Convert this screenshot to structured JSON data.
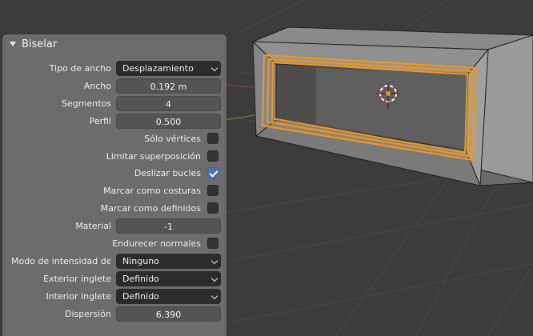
{
  "panel": {
    "title": "Biselar",
    "rows": {
      "width_type": {
        "label": "Tipo de ancho",
        "value": "Desplazamiento"
      },
      "width": {
        "label": "Ancho",
        "value": "0.192 m"
      },
      "segments": {
        "label": "Segmentos",
        "value": "4"
      },
      "profile": {
        "label": "Perfil",
        "value": "0.500"
      },
      "vertex_only": {
        "label": "Sólo vértices",
        "checked": false
      },
      "clamp_overlap": {
        "label": "Limitar superposición",
        "checked": false
      },
      "loop_slide": {
        "label": "Deslizar bucles",
        "checked": true
      },
      "mark_seams": {
        "label": "Marcar como costuras",
        "checked": false
      },
      "mark_sharp": {
        "label": "Marcar como definidos",
        "checked": false
      },
      "material": {
        "label": "Material",
        "value": "-1"
      },
      "harden_normals": {
        "label": "Endurecer normales",
        "checked": false
      },
      "face_strength": {
        "label": "Modo de intensidad de ..",
        "value": "Ninguno"
      },
      "outer_miter": {
        "label": "Exterior inglete",
        "value": "Definido"
      },
      "inner_miter": {
        "label": "Interior inglete",
        "value": "Definido"
      },
      "spread": {
        "label": "Dispersión",
        "value": "6.390"
      }
    }
  },
  "colors": {
    "viewport_bg": "#3b3b3b",
    "grid": "#4a4a4a",
    "selection": "#e8982a",
    "checkbox_on": "#4772b3",
    "axis_red": "#a83a46",
    "axis_green": "#6c9a2e"
  },
  "icons": {
    "collapse": "triangle-down-icon",
    "dropdown": "chevron-down-icon",
    "cursor": "3d-cursor-icon"
  }
}
